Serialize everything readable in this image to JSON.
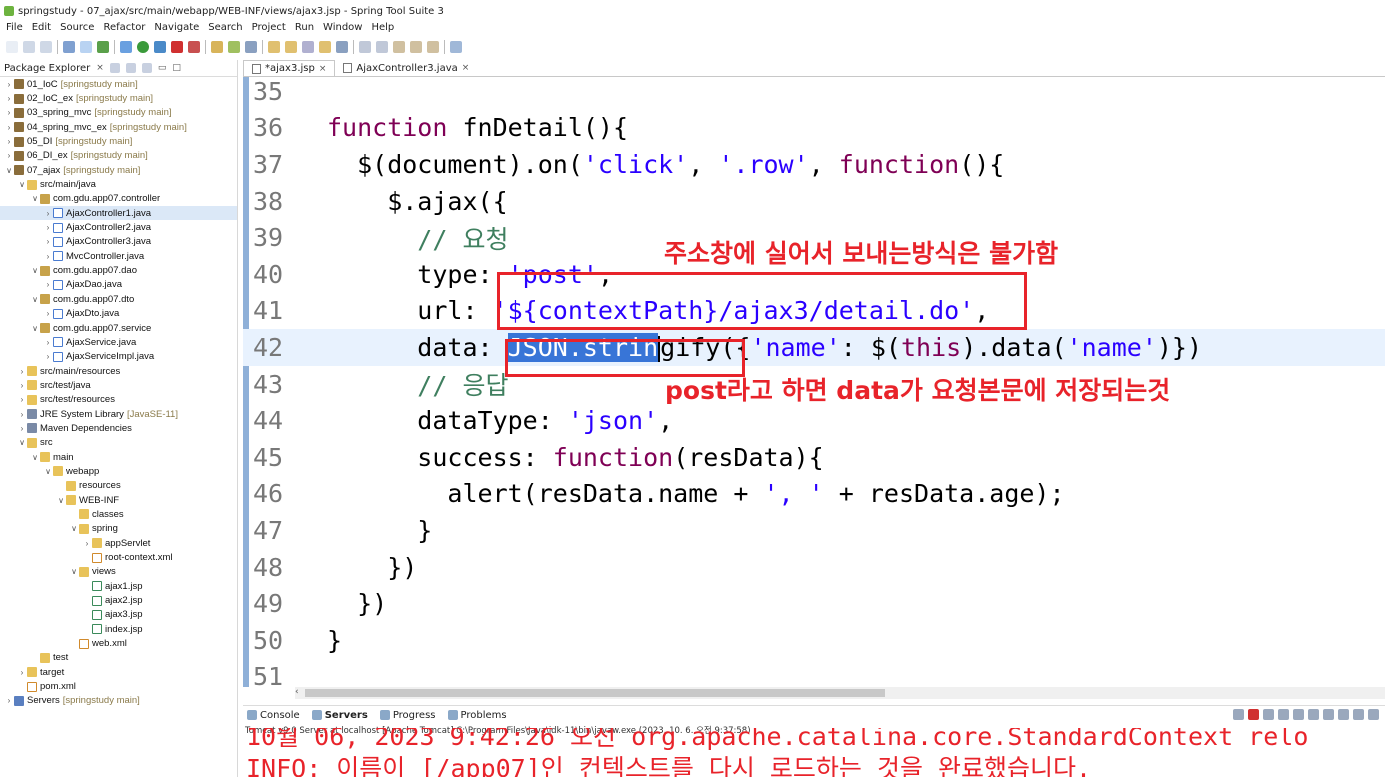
{
  "window": {
    "title": "springstudy - 07_ajax/src/main/webapp/WEB-INF/views/ajax3.jsp - Spring Tool Suite 3"
  },
  "menu": [
    "File",
    "Edit",
    "Source",
    "Refactor",
    "Navigate",
    "Search",
    "Project",
    "Run",
    "Window",
    "Help"
  ],
  "explorer": {
    "tab_label": "Package Explorer",
    "items": [
      {
        "label": "01_IoC",
        "suffix": "[springstudy main]",
        "indent": 0,
        "twisty": ">",
        "icon": "ic-project"
      },
      {
        "label": "02_IoC_ex",
        "suffix": "[springstudy main]",
        "indent": 0,
        "twisty": ">",
        "icon": "ic-project"
      },
      {
        "label": "03_spring_mvc",
        "suffix": "[springstudy main]",
        "indent": 0,
        "twisty": ">",
        "icon": "ic-project"
      },
      {
        "label": "04_spring_mvc_ex",
        "suffix": "[springstudy main]",
        "indent": 0,
        "twisty": ">",
        "icon": "ic-project"
      },
      {
        "label": "05_DI",
        "suffix": "[springstudy main]",
        "indent": 0,
        "twisty": ">",
        "icon": "ic-project"
      },
      {
        "label": "06_DI_ex",
        "suffix": "[springstudy main]",
        "indent": 0,
        "twisty": ">",
        "icon": "ic-project"
      },
      {
        "label": "07_ajax",
        "suffix": "[springstudy main]",
        "indent": 0,
        "twisty": "v",
        "icon": "ic-project"
      },
      {
        "label": "src/main/java",
        "suffix": "",
        "indent": 1,
        "twisty": "v",
        "icon": "ic-folder"
      },
      {
        "label": "com.gdu.app07.controller",
        "suffix": "",
        "indent": 2,
        "twisty": "v",
        "icon": "ic-pkg"
      },
      {
        "label": "AjaxController1.java",
        "suffix": "",
        "indent": 3,
        "twisty": ">",
        "icon": "ic-java",
        "selected": true
      },
      {
        "label": "AjaxController2.java",
        "suffix": "",
        "indent": 3,
        "twisty": ">",
        "icon": "ic-java"
      },
      {
        "label": "AjaxController3.java",
        "suffix": "",
        "indent": 3,
        "twisty": ">",
        "icon": "ic-java"
      },
      {
        "label": "MvcController.java",
        "suffix": "",
        "indent": 3,
        "twisty": ">",
        "icon": "ic-java"
      },
      {
        "label": "com.gdu.app07.dao",
        "suffix": "",
        "indent": 2,
        "twisty": "v",
        "icon": "ic-pkg"
      },
      {
        "label": "AjaxDao.java",
        "suffix": "",
        "indent": 3,
        "twisty": ">",
        "icon": "ic-java"
      },
      {
        "label": "com.gdu.app07.dto",
        "suffix": "",
        "indent": 2,
        "twisty": "v",
        "icon": "ic-pkg"
      },
      {
        "label": "AjaxDto.java",
        "suffix": "",
        "indent": 3,
        "twisty": ">",
        "icon": "ic-java"
      },
      {
        "label": "com.gdu.app07.service",
        "suffix": "",
        "indent": 2,
        "twisty": "v",
        "icon": "ic-pkg"
      },
      {
        "label": "AjaxService.java",
        "suffix": "",
        "indent": 3,
        "twisty": ">",
        "icon": "ic-java"
      },
      {
        "label": "AjaxServiceImpl.java",
        "suffix": "",
        "indent": 3,
        "twisty": ">",
        "icon": "ic-java"
      },
      {
        "label": "src/main/resources",
        "suffix": "",
        "indent": 1,
        "twisty": ">",
        "icon": "ic-folder"
      },
      {
        "label": "src/test/java",
        "suffix": "",
        "indent": 1,
        "twisty": ">",
        "icon": "ic-folder"
      },
      {
        "label": "src/test/resources",
        "suffix": "",
        "indent": 1,
        "twisty": ">",
        "icon": "ic-folder"
      },
      {
        "label": "JRE System Library",
        "suffix": "[JavaSE-11]",
        "indent": 1,
        "twisty": ">",
        "icon": "ic-lib"
      },
      {
        "label": "Maven Dependencies",
        "suffix": "",
        "indent": 1,
        "twisty": ">",
        "icon": "ic-lib"
      },
      {
        "label": "src",
        "suffix": "",
        "indent": 1,
        "twisty": "v",
        "icon": "ic-folder"
      },
      {
        "label": "main",
        "suffix": "",
        "indent": 2,
        "twisty": "v",
        "icon": "ic-folder"
      },
      {
        "label": "webapp",
        "suffix": "",
        "indent": 3,
        "twisty": "v",
        "icon": "ic-folder"
      },
      {
        "label": "resources",
        "suffix": "",
        "indent": 4,
        "twisty": "",
        "icon": "ic-folder"
      },
      {
        "label": "WEB-INF",
        "suffix": "",
        "indent": 4,
        "twisty": "v",
        "icon": "ic-folder"
      },
      {
        "label": "classes",
        "suffix": "",
        "indent": 5,
        "twisty": "",
        "icon": "ic-folder"
      },
      {
        "label": "spring",
        "suffix": "",
        "indent": 5,
        "twisty": "v",
        "icon": "ic-folder"
      },
      {
        "label": "appServlet",
        "suffix": "",
        "indent": 6,
        "twisty": ">",
        "icon": "ic-folder"
      },
      {
        "label": "root-context.xml",
        "suffix": "",
        "indent": 6,
        "twisty": "",
        "icon": "ic-xml"
      },
      {
        "label": "views",
        "suffix": "",
        "indent": 5,
        "twisty": "v",
        "icon": "ic-folder"
      },
      {
        "label": "ajax1.jsp",
        "suffix": "",
        "indent": 6,
        "twisty": "",
        "icon": "ic-jsp"
      },
      {
        "label": "ajax2.jsp",
        "suffix": "",
        "indent": 6,
        "twisty": "",
        "icon": "ic-jsp"
      },
      {
        "label": "ajax3.jsp",
        "suffix": "",
        "indent": 6,
        "twisty": "",
        "icon": "ic-jsp"
      },
      {
        "label": "index.jsp",
        "suffix": "",
        "indent": 6,
        "twisty": "",
        "icon": "ic-jsp"
      },
      {
        "label": "web.xml",
        "suffix": "",
        "indent": 5,
        "twisty": "",
        "icon": "ic-xml"
      },
      {
        "label": "test",
        "suffix": "",
        "indent": 2,
        "twisty": "",
        "icon": "ic-folder"
      },
      {
        "label": "target",
        "suffix": "",
        "indent": 1,
        "twisty": ">",
        "icon": "ic-folder"
      },
      {
        "label": "pom.xml",
        "suffix": "",
        "indent": 1,
        "twisty": "",
        "icon": "ic-xml"
      },
      {
        "label": "Servers",
        "suffix": "[springstudy main]",
        "indent": 0,
        "twisty": ">",
        "icon": "ic-srv"
      }
    ]
  },
  "editor": {
    "tabs": [
      {
        "label": "*ajax3.jsp",
        "active": true
      },
      {
        "label": "AjaxController3.java",
        "active": false
      }
    ],
    "current_line": 42,
    "lines": [
      {
        "n": "35",
        "tokens": []
      },
      {
        "n": "36",
        "tokens": [
          [
            "kw",
            "function"
          ],
          [
            "",
            " fnDetail(){"
          ]
        ]
      },
      {
        "n": "37",
        "tokens": [
          [
            "",
            "  $(document).on("
          ],
          [
            "str",
            "'click'"
          ],
          [
            "",
            ", "
          ],
          [
            "str",
            "'.row'"
          ],
          [
            "",
            ", "
          ],
          [
            "kw",
            "function"
          ],
          [
            "",
            "(){"
          ]
        ]
      },
      {
        "n": "38",
        "tokens": [
          [
            "",
            "    $.ajax({"
          ]
        ]
      },
      {
        "n": "39",
        "tokens": [
          [
            "cm",
            "      // 요청"
          ]
        ]
      },
      {
        "n": "40",
        "tokens": [
          [
            "",
            "      type: "
          ],
          [
            "str",
            "'post'"
          ],
          [
            "",
            ","
          ]
        ]
      },
      {
        "n": "41",
        "tokens": [
          [
            "",
            "      url: "
          ],
          [
            "str",
            "'${contextPath}/ajax3/detail.do'"
          ],
          [
            "",
            ","
          ]
        ]
      },
      {
        "n": "42",
        "tokens": [
          [
            "",
            "      data: "
          ],
          [
            "sel",
            "JSON.strin"
          ],
          [
            "cursor",
            ""
          ],
          [
            "",
            "gify({"
          ],
          [
            "str",
            "'name'"
          ],
          [
            "",
            ": $("
          ],
          [
            "kw",
            "this"
          ],
          [
            "",
            ").data("
          ],
          [
            "str",
            "'name'"
          ],
          [
            "",
            ")})"
          ]
        ]
      },
      {
        "n": "43",
        "tokens": [
          [
            "cm",
            "      // 응답"
          ]
        ]
      },
      {
        "n": "44",
        "tokens": [
          [
            "",
            "      dataType: "
          ],
          [
            "str",
            "'json'"
          ],
          [
            "",
            ","
          ]
        ]
      },
      {
        "n": "45",
        "tokens": [
          [
            "",
            "      success: "
          ],
          [
            "kw",
            "function"
          ],
          [
            "",
            "(resData){"
          ]
        ]
      },
      {
        "n": "46",
        "tokens": [
          [
            "",
            "        alert(resData.name + "
          ],
          [
            "str",
            "', '"
          ],
          [
            "",
            " + resData.age);"
          ]
        ]
      },
      {
        "n": "47",
        "tokens": [
          [
            "",
            "      }"
          ]
        ]
      },
      {
        "n": "48",
        "tokens": [
          [
            "",
            "    })"
          ]
        ]
      },
      {
        "n": "49",
        "tokens": [
          [
            "",
            "  })"
          ]
        ]
      },
      {
        "n": "50",
        "tokens": [
          [
            "",
            "}"
          ]
        ]
      },
      {
        "n": "51",
        "tokens": []
      }
    ]
  },
  "annotations": {
    "note1": "주소창에 실어서 보내는방식은 불가함",
    "note2": "post라고 하면 data가 요청본문에 저장되는것"
  },
  "console": {
    "tabs": [
      "Console",
      "Servers",
      "Progress",
      "Problems"
    ],
    "active_tab": "Servers",
    "status": "Tomcat v9.0 Server at localhost [Apache Tomcat] C:\\Program Files\\Java\\jdk-11\\bin\\javaw.exe  (2023. 10. 6. 오전 9:37:58)",
    "line1": "10월 06, 2023 9:42:26 오전 org.apache.catalina.core.StandardContext relo",
    "line2": "INFO: 이름이 [/app07]인 컨텍스트를 다시 로드하는 것을 완료했습니다."
  },
  "colors": {
    "annotation_red": "#e8232a",
    "selection": "#3875d7",
    "keyword": "#7f0055",
    "string": "#2a00ff"
  }
}
